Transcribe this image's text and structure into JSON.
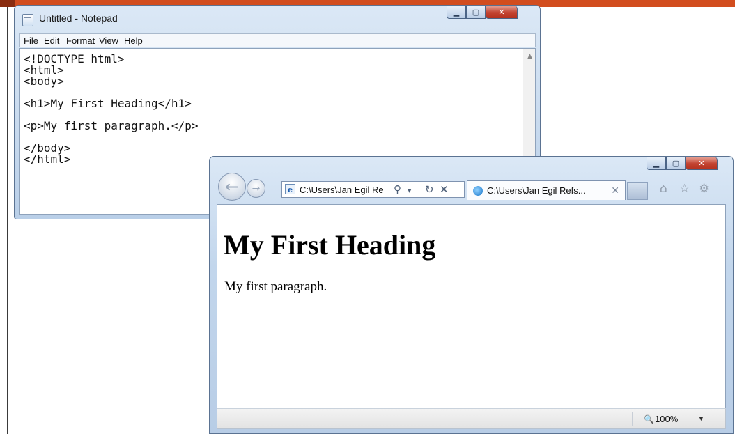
{
  "notepad": {
    "title": "Untitled - Notepad",
    "menu": [
      "File",
      "Edit",
      "Format",
      "View",
      "Help"
    ],
    "content": "<!DOCTYPE html>\n<html>\n<body>\n\n<h1>My First Heading</h1>\n\n<p>My first paragraph.</p>\n\n</body>\n</html>",
    "window_controls": [
      "minimize-icon",
      "maximize-icon",
      "close-icon"
    ]
  },
  "browser": {
    "address": "C:\\Users\\Jan Egil Re",
    "tab_title": "C:\\Users\\Jan Egil Refs...",
    "toolbar_icons": [
      "home-icon",
      "star-icon",
      "gear-icon"
    ],
    "page": {
      "heading": "My First Heading",
      "paragraph": "My first paragraph."
    },
    "zoom": "100%"
  },
  "colors": {
    "banner": "#d24d1e",
    "close_button": "#c34331",
    "window_frame": "#b9cfe8"
  }
}
